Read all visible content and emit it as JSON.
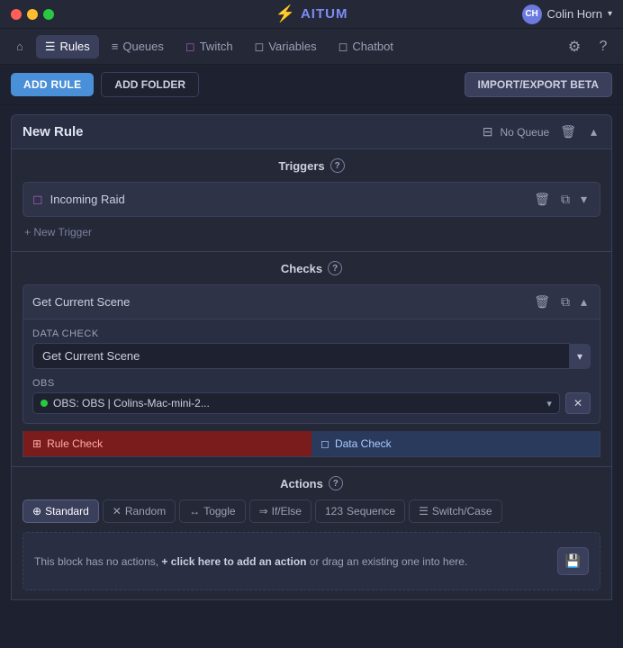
{
  "titlebar": {
    "user": "Colin Horn",
    "user_initials": "CH",
    "app_name": "AITUM"
  },
  "navbar": {
    "home_icon": "⌂",
    "items": [
      {
        "id": "rules",
        "label": "Rules",
        "icon": "☰",
        "active": true
      },
      {
        "id": "queues",
        "label": "Queues",
        "icon": "≡"
      },
      {
        "id": "twitch",
        "label": "Twitch",
        "icon": "◻"
      },
      {
        "id": "variables",
        "label": "Variables",
        "icon": "◻"
      },
      {
        "id": "chatbot",
        "label": "Chatbot",
        "icon": "◻"
      }
    ],
    "gear_icon": "⚙",
    "help_icon": "?"
  },
  "actionbar": {
    "add_rule_label": "ADD RULE",
    "add_folder_label": "ADD FOLDER",
    "import_export_label": "IMPORT/EXPORT BETA"
  },
  "rule": {
    "title": "New Rule",
    "queue": "No Queue",
    "triggers_label": "Triggers",
    "triggers_help": "?",
    "trigger_item": "Incoming Raid",
    "trigger_icon": "◻",
    "new_trigger_label": "+ New Trigger",
    "checks_label": "Checks",
    "checks_help": "?",
    "check_item": "Get Current Scene",
    "data_check_label": "Data Check",
    "data_check_select": "Get Current Scene",
    "obs_label": "OBS",
    "obs_value": "OBS: OBS | Colins-Mac-mini-2...",
    "rule_check_tab": "Rule Check",
    "data_check_tab": "Data Check",
    "actions_label": "Actions",
    "actions_help": "?",
    "action_tabs": [
      {
        "id": "standard",
        "label": "Standard",
        "icon": "⊕",
        "active": true
      },
      {
        "id": "random",
        "label": "Random",
        "icon": "✕"
      },
      {
        "id": "toggle",
        "label": "Toggle",
        "icon": "↔"
      },
      {
        "id": "ifelse",
        "label": "If/Else",
        "icon": "⇒"
      },
      {
        "id": "sequence",
        "label": "Sequence",
        "icon": "123"
      },
      {
        "id": "switchcase",
        "label": "Switch/Case",
        "icon": "☰"
      }
    ],
    "actions_empty_text": "This block has no actions,",
    "actions_empty_cta": "+ click here to add an action",
    "actions_empty_suffix": "or drag an existing one into here."
  }
}
